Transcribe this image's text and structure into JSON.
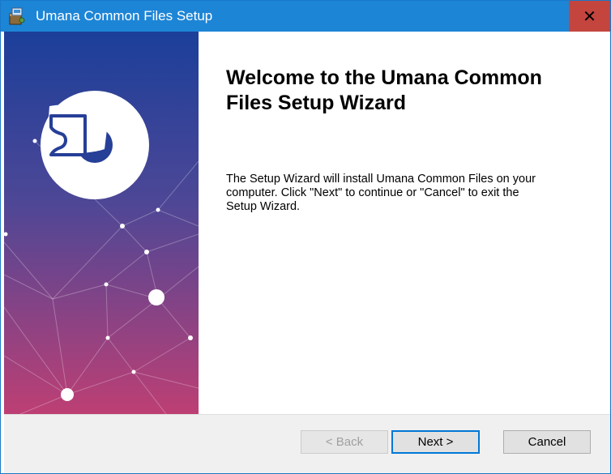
{
  "window": {
    "title": "Umana Common Files Setup",
    "close_label": "✕"
  },
  "icons": {
    "app": "installer-package-icon",
    "close": "close-icon",
    "logo": "puzzle-logo-icon"
  },
  "colors": {
    "titlebar": "#1d85d6",
    "close_button": "#c3453e",
    "banner_top": "#1b3f9a",
    "banner_bottom": "#bd3f74",
    "next_border": "#0078d7"
  },
  "content": {
    "heading": "Welcome to the Umana Common Files Setup Wizard",
    "body": "The Setup Wizard will install Umana Common Files on your\ncomputer.  Click \"Next\" to continue or \"Cancel\" to exit the\nSetup Wizard."
  },
  "buttons": {
    "back": "< Back",
    "next": "Next >",
    "cancel": "Cancel"
  }
}
